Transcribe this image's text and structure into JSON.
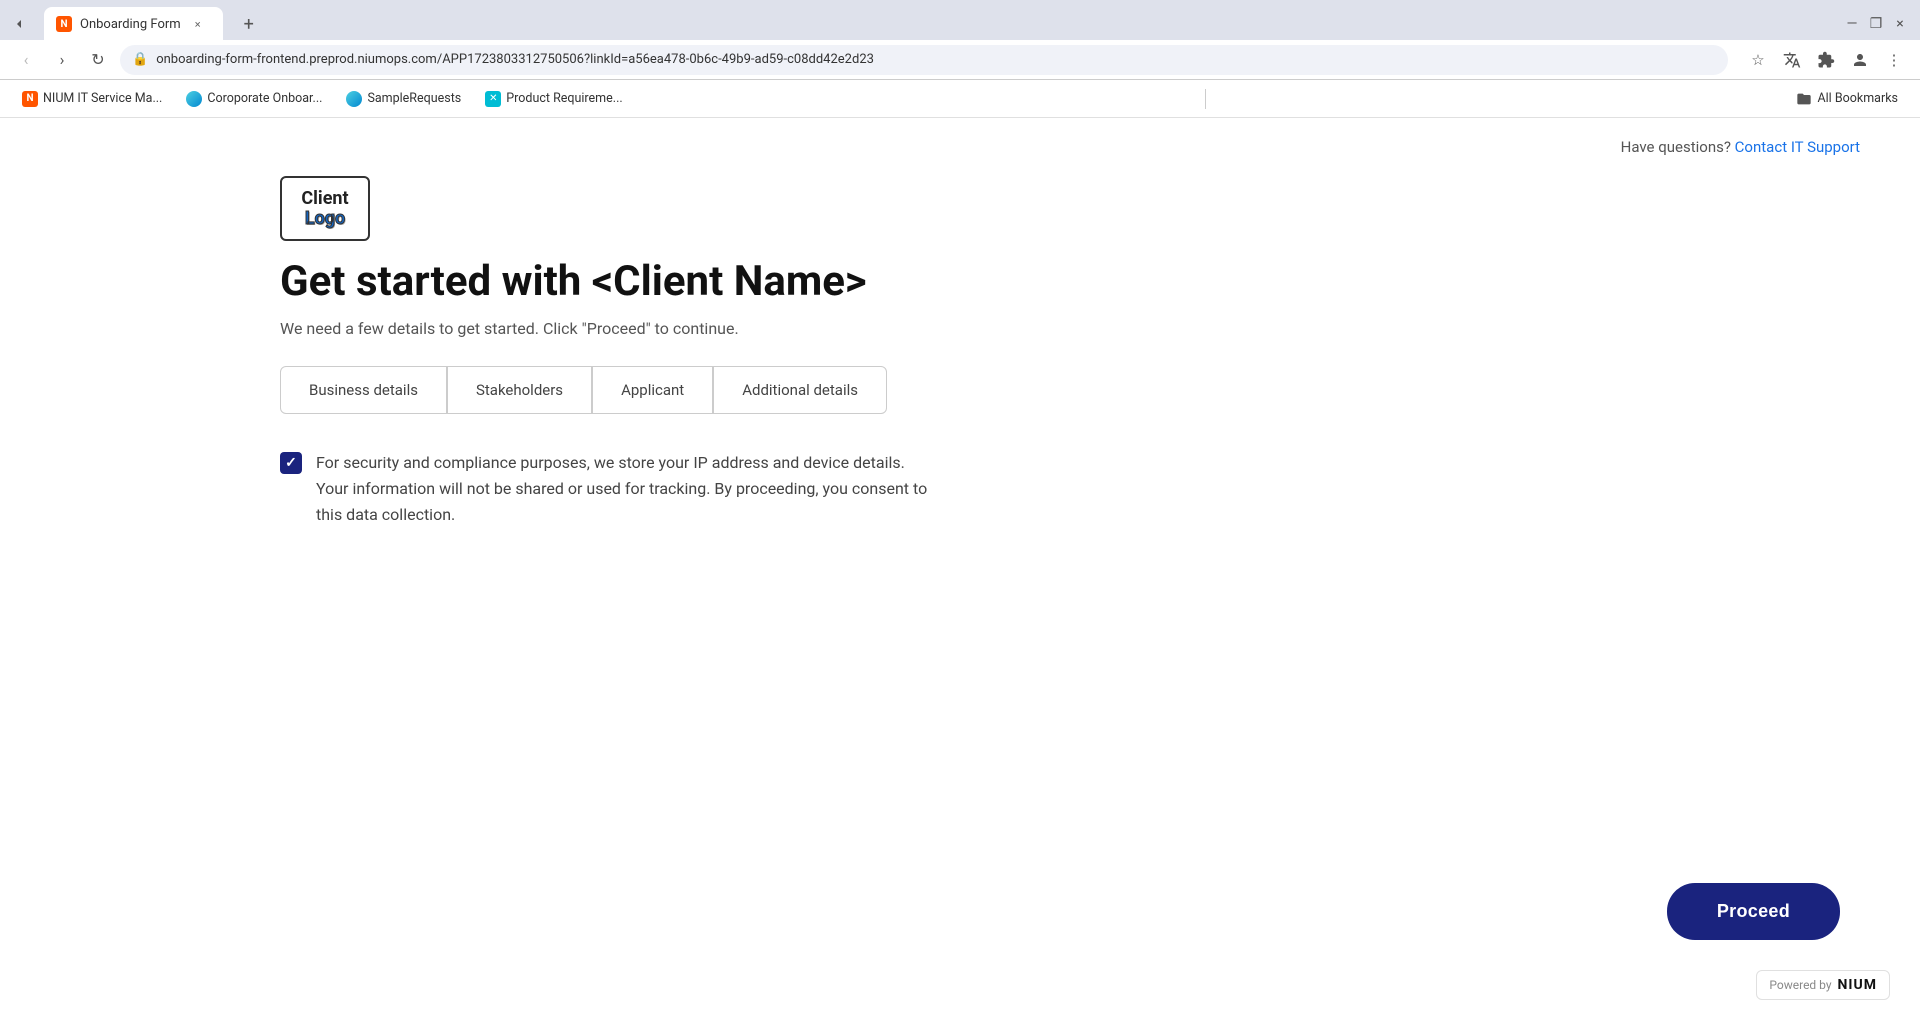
{
  "browser": {
    "tab": {
      "favicon_label": "N",
      "title": "Onboarding Form",
      "close_label": "×"
    },
    "new_tab_label": "+",
    "nav": {
      "back_label": "‹",
      "forward_label": "›",
      "refresh_label": "↻"
    },
    "address": {
      "url": "onboarding-form-frontend.preprod.niumops.com/APP1723803312750506?linkId=a56ea478-0b6c-49b9-ad59-c08dd42e2d23",
      "security_icon": "🔒"
    },
    "window_controls": {
      "minimize": "—",
      "maximize": "❐",
      "close": "×"
    },
    "bookmarks": [
      {
        "id": "nium",
        "label": "NIUM IT Service Ma..."
      },
      {
        "id": "corporate",
        "label": "Coroporate Onboar..."
      },
      {
        "id": "sample",
        "label": "SampleRequests"
      },
      {
        "id": "product",
        "label": "Product Requireme..."
      }
    ],
    "bookmarks_folder_label": "All Bookmarks"
  },
  "page": {
    "questions_text": "Have questions?",
    "contact_link_text": "Contact IT Support",
    "logo": {
      "line1": "Client",
      "line2": "Logo"
    },
    "heading": "Get started with <Client Name>",
    "subtitle": "We need a few details to get started. Click \"Proceed\" to continue.",
    "steps": [
      {
        "label": "Business details"
      },
      {
        "label": "Stakeholders"
      },
      {
        "label": "Applicant"
      },
      {
        "label": "Additional details"
      }
    ],
    "consent_text": "For security and compliance purposes, we store your IP address and device details.\nYour information will not be shared or used for tracking. By proceeding, you consent to\nthis data collection.",
    "proceed_button_label": "Proceed",
    "powered_by_label": "Powered by",
    "nium_label": "NIUM"
  }
}
